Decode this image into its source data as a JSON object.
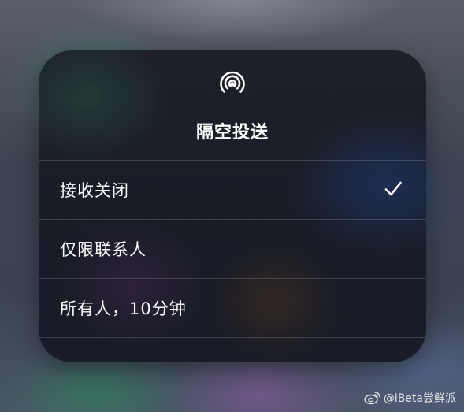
{
  "panel": {
    "icon": "airdrop-icon",
    "title": "隔空投送"
  },
  "options": [
    {
      "label": "接收关闭",
      "selected": true,
      "icon": "checkmark-icon"
    },
    {
      "label": "仅限联系人",
      "selected": false
    },
    {
      "label": "所有人，10分钟",
      "selected": false
    }
  ],
  "watermark": {
    "icon": "weibo-icon",
    "text": "@iBeta尝鲜派"
  },
  "colors": {
    "text": "#ffffff",
    "separator": "rgba(255,255,255,0.16)"
  }
}
